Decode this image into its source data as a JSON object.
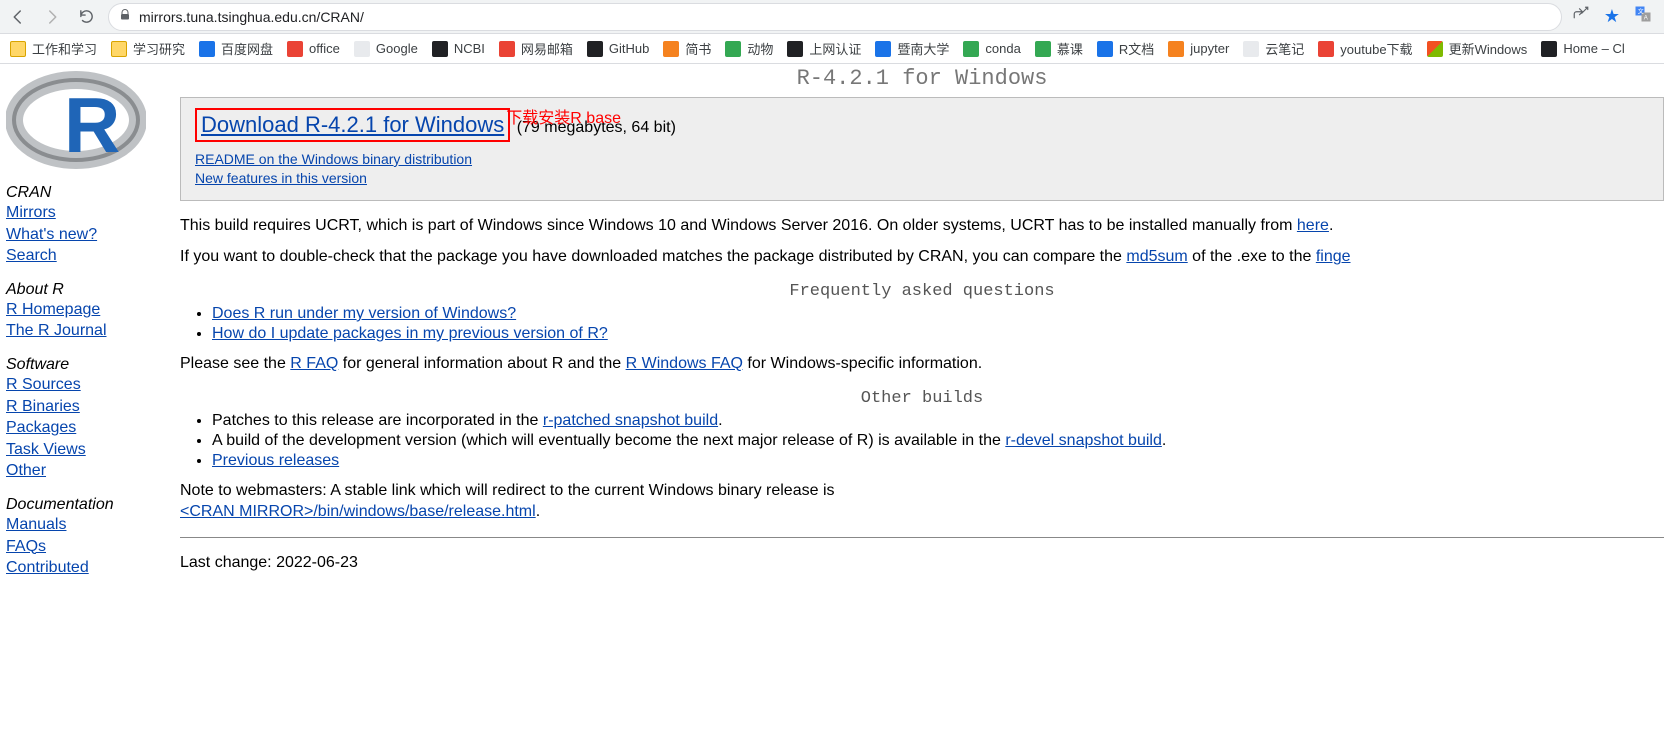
{
  "browser": {
    "url": "mirrors.tuna.tsinghua.edu.cn/CRAN/"
  },
  "bookmarks": [
    {
      "label": "工作和学习",
      "style": "bm-folder"
    },
    {
      "label": "学习研究",
      "style": "bm-folder"
    },
    {
      "label": "百度网盘",
      "style": "bm-blue"
    },
    {
      "label": "office",
      "style": "bm-red"
    },
    {
      "label": "Google",
      "style": "bm-generic"
    },
    {
      "label": "NCBI",
      "style": "bm-dark"
    },
    {
      "label": "网易邮箱",
      "style": "bm-red"
    },
    {
      "label": "GitHub",
      "style": "bm-dark"
    },
    {
      "label": "简书",
      "style": "bm-orange"
    },
    {
      "label": "动物",
      "style": "bm-green"
    },
    {
      "label": "上网认证",
      "style": "bm-dark"
    },
    {
      "label": "暨南大学",
      "style": "bm-blue"
    },
    {
      "label": "conda",
      "style": "bm-green"
    },
    {
      "label": "慕课",
      "style": "bm-green"
    },
    {
      "label": "R文档",
      "style": "bm-blue"
    },
    {
      "label": "jupyter",
      "style": "bm-orange"
    },
    {
      "label": "云笔记",
      "style": "bm-generic"
    },
    {
      "label": "youtube下载",
      "style": "bm-red"
    },
    {
      "label": "更新Windows",
      "style": "bm-ms"
    },
    {
      "label": "Home – Cl",
      "style": "bm-dark"
    }
  ],
  "sidebar": {
    "cran": {
      "title": "CRAN",
      "items": [
        {
          "label": "Mirrors"
        },
        {
          "label": "What's new?"
        },
        {
          "label": "Search"
        }
      ]
    },
    "about": {
      "title": "About R",
      "items": [
        {
          "label": "R Homepage"
        },
        {
          "label": "The R Journal"
        }
      ]
    },
    "software": {
      "title": "Software",
      "items": [
        {
          "label": "R Sources"
        },
        {
          "label": "R Binaries"
        },
        {
          "label": "Packages"
        },
        {
          "label": "Task Views"
        },
        {
          "label": "Other"
        }
      ]
    },
    "docs": {
      "title": "Documentation",
      "items": [
        {
          "label": "Manuals"
        },
        {
          "label": "FAQs"
        },
        {
          "label": "Contributed"
        }
      ]
    }
  },
  "page": {
    "title": "R-4.2.1 for Windows",
    "annotation": "下载安装R base",
    "download_link": "Download R-4.2.1 for Windows",
    "download_meta": "(79 megabytes, 64 bit)",
    "readme_link": "README on the Windows binary distribution",
    "newfeat_link": "New features in this version",
    "para1_a": "This build requires UCRT, which is part of Windows since Windows 10 and Windows Server 2016. On older systems, UCRT has to be installed manually from ",
    "para1_link": "here",
    "para1_b": ".",
    "para2_a": "If you want to double-check that the package you have downloaded matches the package distributed by CRAN, you can compare the ",
    "para2_link1": "md5sum",
    "para2_b": " of the .exe to the ",
    "para2_link2": "finge",
    "faq_heading": "Frequently asked questions",
    "faq1": "Does R run under my version of Windows?",
    "faq2": "How do I update packages in my previous version of R?",
    "faq_para_a": "Please see the ",
    "faq_para_link1": "R FAQ",
    "faq_para_b": " for general information about R and the ",
    "faq_para_link2": "R Windows FAQ",
    "faq_para_c": " for Windows-specific information.",
    "other_heading": "Other builds",
    "other1_a": "Patches to this release are incorporated in the ",
    "other1_link": "r-patched snapshot build",
    "other1_b": ".",
    "other2_a": "A build of the development version (which will eventually become the next major release of R) is available in the ",
    "other2_link": "r-devel snapshot build",
    "other2_b": ".",
    "other3_link": "Previous releases",
    "webmaster_a": "Note to webmasters: A stable link which will redirect to the current Windows binary release is",
    "webmaster_link": "<CRAN MIRROR>/bin/windows/base/release.html",
    "webmaster_b": ".",
    "last_change": "Last change: 2022-06-23"
  }
}
